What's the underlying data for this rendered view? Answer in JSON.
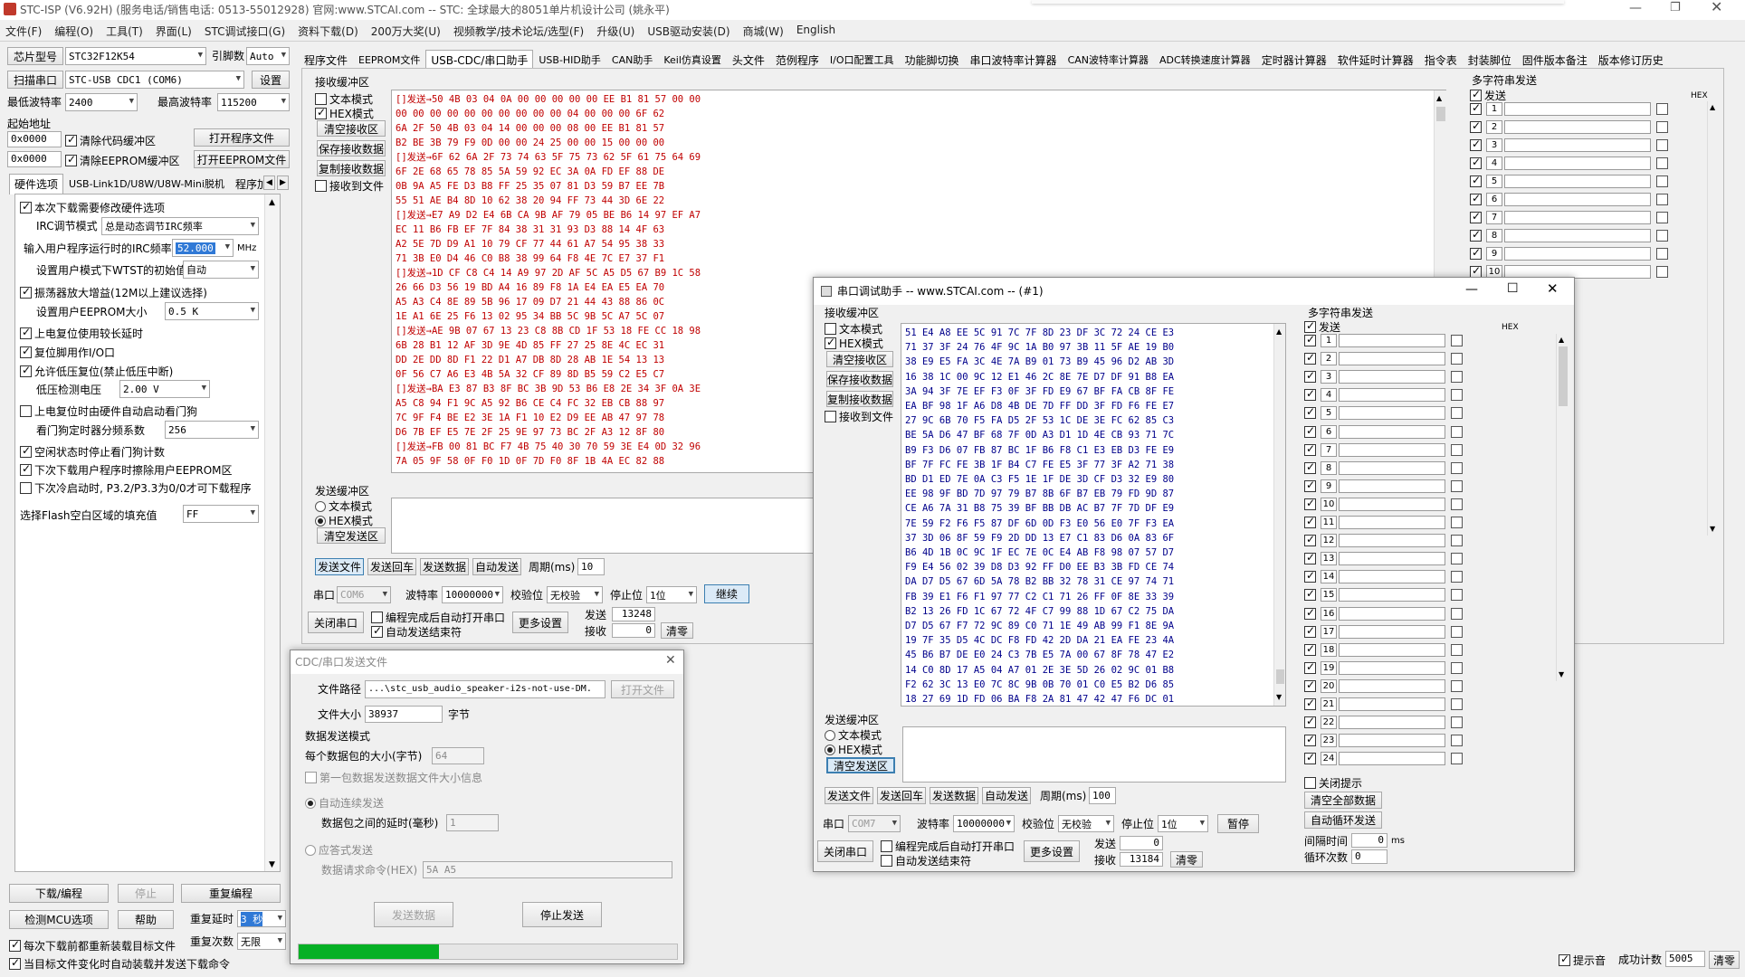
{
  "window": {
    "title": "STC-ISP (V6.92H) (服务电话/销售电话: 0513-55012928) 官网:www.STCAI.com  -- STC: 全球最大的8051单片机设计公司 (姚永平)"
  },
  "menu": [
    "文件(F)",
    "编程(O)",
    "工具(T)",
    "界面(L)",
    "STC调试接口(G)",
    "资料下载(D)",
    "200万大奖(U)",
    "视频教学/技术论坛/选型(F)",
    "升级(U)",
    "USB驱动安装(D)",
    "商城(W)",
    "English"
  ],
  "left": {
    "chip_label": "芯片型号",
    "chip_value": "STC32F12K54",
    "pin_label": "引脚数",
    "pin_value": "Auto",
    "scan_btn": "扫描串口",
    "port_value": "STC-USB CDC1 (COM6)",
    "settings_btn": "设置",
    "min_baud_label": "最低波特率",
    "min_baud": "2400",
    "max_baud_label": "最高波特率",
    "max_baud": "115200",
    "start_addr_label": "起始地址",
    "addr1": "0x0000",
    "clear_code": "清除代码缓冲区",
    "open_prog": "打开程序文件",
    "addr2": "0x0000",
    "clear_eeprom": "清除EEPROM缓冲区",
    "open_eeprom": "打开EEPROM文件",
    "tabs": [
      "硬件选项",
      "USB-Link1D/U8W/U8W-Mini脱机",
      "程序加"
    ],
    "opts": {
      "o1": "本次下载需要修改硬件选项",
      "irc_mode_label": "IRC调节模式",
      "irc_mode": "总是动态调节IRC频率",
      "irc_freq_label": "输入用户程序运行时的IRC频率",
      "irc_freq": "52.000",
      "mhz": "MHz",
      "wtst_label": "设置用户模式下WTST的初始值",
      "wtst": "自动",
      "o2": "振荡器放大增益(12M以上建议选择)",
      "eeprom_label": "设置用户EEPROM大小",
      "eeprom": "0.5 K",
      "o3": "上电复位使用较长延时",
      "o4": "复位脚用作I/O口",
      "o5": "允许低压复位(禁止低压中断)",
      "lv_label": "低压检测电压",
      "lv": "2.00 V",
      "o6": "上电复位时由硬件自动启动看门狗",
      "wdt_label": "看门狗定时器分频系数",
      "wdt": "256",
      "o7": "空闲状态时停止看门狗计数",
      "o8": "下次下载用户程序时擦除用户EEPROM区",
      "o9": "下次冷启动时, P3.2/P3.3为0/0才可下载程序",
      "fill_label": "选择Flash空白区域的填充值",
      "fill": "FF"
    },
    "dl_btn": "下载/编程",
    "stop_btn": "停止",
    "redl_btn": "重复编程",
    "check_btn": "检测MCU选项",
    "help_btn": "帮助",
    "delay_label": "重复延时",
    "delay_val": "3 秒",
    "reload_cb": "每次下载前都重新装载目标文件",
    "count_label": "重复次数",
    "count_val": "无限",
    "auto_cb": "当目标文件变化时自动装载并发送下载命令"
  },
  "top_tabs": [
    "程序文件",
    "EEPROM文件",
    "USB-CDC/串口助手",
    "USB-HID助手",
    "CAN助手",
    "Keil仿真设置",
    "头文件",
    "范例程序",
    "I/O口配置工具",
    "功能脚切换",
    "串口波特率计算器",
    "CAN波特率计算器",
    "ADC转换速度计算器",
    "定时器计算器",
    "软件延时计算器",
    "指令表",
    "封装脚位",
    "固件版本备注",
    "版本修订历史"
  ],
  "main": {
    "recv_title": "接收缓冲区",
    "text_mode": "文本模式",
    "hex_mode": "HEX模式",
    "clear_recv": "清空接收区",
    "save_recv": "保存接收数据",
    "copy_recv": "复制接收数据",
    "recv_file": "接收到文件",
    "hex_lines": [
      {
        "s": "[]发送→50 4B 03 04 0A 00 00 00 00 00 EE B1 81 57 00 00",
        "r": true
      },
      {
        "s": "00 00 00 00 00 00 00 00 00 00 04 00 00 00 6F 62",
        "r": true
      },
      {
        "s": "6A 2F 50 4B 03 04 14 00 00 00 08 00 EE B1 81 57",
        "r": true
      },
      {
        "s": "B2 BE 3B 79 F9 0D 00 00 24 25 00 00 15 00 00 00",
        "r": true
      },
      {
        "s": "[]发送→6F 62 6A 2F 73 74 63 5F 75 73 62 5F 61 75 64 69",
        "r": true
      },
      {
        "s": "6F 2E 68 65 78 85 5A 59 92 EC 3A 0A FD EF 88 DE",
        "r": true
      },
      {
        "s": "0B 9A A5 FE D3 B8 FF 25 35 07 81 D3 59 B7 EE 7B",
        "r": true
      },
      {
        "s": "55 51 AE B4 8D 10 62 38 20 94 FF 73 44 3D 6E 22",
        "r": true
      },
      {
        "s": "[]发送→E7 A9 D2 E4 6B CA 9B AF 79 05 BE B6 14 97 EF A7",
        "r": true
      },
      {
        "s": "EC 11 B6 FB EF 7F 84 38 31 31 93 D3 88 14 4F 63",
        "r": true
      },
      {
        "s": "A2 5E 7D D9 A1 10 79 CF 77 44 61 A7 54 95 38 33",
        "r": true
      },
      {
        "s": "71 3B E0 D4 46 C0 B8 38 99 64 F8 4E 7C E7 37 F1",
        "r": true
      },
      {
        "s": "[]发送→1D CF C8 C4 14 A9 97 2D AF 5C A5 D5 67 B9 1C 58",
        "r": true
      },
      {
        "s": "26 66 D3 56 19 BD A4 16 89 F8 1A E4 EA E5 EA 70",
        "r": true
      },
      {
        "s": "A5 A3 C4 8E 89 5B 96 17 09 D7 21 44 43 88 86 0C",
        "r": true
      },
      {
        "s": "1E A1 6E 25 F6 13 02 95 34 BB 5C 9B 5C A7 5C 07",
        "r": true
      },
      {
        "s": "[]发送→AE 9B 07 67 13 23 C8 8B CD 1F 53 18 FE CC 18 98",
        "r": true
      },
      {
        "s": "6B 28 B1 12 AF 3D 9E 4D 85 FF 27 25 8E 4C EC 31",
        "r": true
      },
      {
        "s": "DD 2E DD 8D F1 22 D1 A7 DB 8D 28 AB 1E 54 13 13",
        "r": true
      },
      {
        "s": "0F 56 C7 A6 E3 4B 5A 32 CF 89 8D B5 59 C2 E5 C7",
        "r": true
      },
      {
        "s": "[]发送→BA E3 87 B3 8F BC 3B 9D 53 B6 E8 2E 34 3F 0A 3E",
        "r": true
      },
      {
        "s": "A5 C8 94 F1 9C A5 92 B6 CE C4 FC 32 EB CB 88 97",
        "r": true
      },
      {
        "s": "7C 9F F4 BE E2 3E 1A F1 10 E2 D9 EE AB 47 97 78",
        "r": true
      },
      {
        "s": "D6 7B EF E5 7E 2F 25 9E 97 73 BC 2F A3 12 8F 80",
        "r": true
      },
      {
        "s": "[]发送→FB 00 81 BC F7 4B 75 40 30 70 59 3E E4 0D 32 96",
        "r": true
      },
      {
        "s": "7A 05 9F 58 0F F0 1D 0F 7D F0 8F 1B 4A EC 82 88",
        "r": true
      }
    ],
    "send_title": "发送缓冲区",
    "clear_send": "清空发送区",
    "send_file": "发送文件",
    "send_back": "发送回车",
    "send_data": "发送数据",
    "auto_send": "自动发送",
    "period_label": "周期(ms)",
    "period": "10",
    "port_label": "串口",
    "port": "COM6",
    "baud_label": "波特率",
    "baud": "10000000",
    "parity_label": "校验位",
    "parity": "无校验",
    "stop_label": "停止位",
    "stopbit": "1位",
    "continue_btn": "继续",
    "close_port": "关闭串口",
    "cb_open": "编程完成后自动打开串口",
    "cb_end": "自动发送结束符",
    "more_settings": "更多设置",
    "sent_label": "发送",
    "sent": "13248",
    "recv_label": "接收",
    "recv": "0",
    "clear_btn": "清零"
  },
  "multi": {
    "title": "多字符串发送",
    "send_col": "发送",
    "hex_col": "HEX",
    "rows": [
      "1",
      "2",
      "3",
      "4",
      "5",
      "6",
      "7",
      "8",
      "9",
      "10"
    ]
  },
  "status": {
    "tip": "提示音",
    "success_label": "成功计数",
    "success": "5005",
    "clear": "清零"
  },
  "file_dialog": {
    "title": "CDC/串口发送文件",
    "path_label": "文件路径",
    "path": "...\\stc_usb_audio_speaker-i2s-not-use-DM.",
    "open_file": "打开文件",
    "size_label": "文件大小",
    "size": "38937",
    "size_unit": "字节",
    "mode_title": "数据发送模式",
    "pkt_label": "每个数据包的大小(字节)",
    "pkt": "64",
    "first_pkt": "第一包数据发送数据文件大小信息",
    "auto_mode": "自动连续发送",
    "delay_label": "数据包之间的延时(毫秒)",
    "delay": "1",
    "reply_mode": "应答式发送",
    "req_label": "数据请求命令(HEX)",
    "req": "5A A5",
    "send_btn": "发送数据",
    "stop_btn": "停止发送",
    "progress": 0.37
  },
  "assist": {
    "title": "串口调试助手 -- www.STCAI.com -- (#1)",
    "recv_title": "接收缓冲区",
    "text_mode": "文本模式",
    "hex_mode": "HEX模式",
    "clear_recv": "清空接收区",
    "save_recv": "保存接收数据",
    "copy_recv": "复制接收数据",
    "recv_file": "接收到文件",
    "hex_lines": [
      "51 E4 A8 EE 5C 91 7C 7F 8D 23 DF 3C 72 24 CE E3",
      "71 37 3F 24 76 4F 9C 1A B0 97 3B 11 5F AE 19 B0",
      "38 E9 E5 FA 3C 4E 7A B9 01 73 B9 45 96 D2 AB 3D",
      "16 38 1C 00 9C 12 E1 46 2C 8E 7E D7 DF 91 B8 EA",
      "3A 94 3F 7E EF F3 0F 3F FD E9 67 BF FA CB 8F FE",
      "EA BF 98 1F A6 D8 4B DE 7D FF DD 3F FD F6 FE E7",
      "27 9C 6B 70 F5 FA D5 2F 53 1C DE 3E FC 62 85 C3",
      "BE 5A D6 47 BF 68 7F 0D A3 D1 1D 4E CB 93 71 7C",
      "B9 F3 D6 07 FB 87 BC 1F B6 F8 C1 E3 EB D3 FE E9",
      "BF 7F FC FE 3B 1F B4 C7 FE E5 3F 77 3F A2 71 38",
      "BD D1 ED 7E 0A C3 F5 1E 1F DE 3D CF D3 32 E9 80",
      "EE 98 9F BD 7D 97 79 B7 8B 6F B7 EB 79 FD 9D 87",
      "CE A6 7A 31 B8 75 39 BF BB DB AC B7 7F 7D DF E9",
      "7E 59 F2 F6 F5 87 DF 6D 0D F3 E0 56 E0 7F F3 EA",
      "37 3D 06 8F 59 F9 2D DD 13 E7 C1 83 D6 0A 83 6F",
      "B6 4D 1B 0C 9C 1F EC 7E 0C E4 AB F8 98 07 57 D7",
      "F9 E4 56 02 39 D8 D3 92 FF D0 EE B3 3B FD CE 74",
      "DA D7 D5 67 6D 5A 78 B2 BB 32 78 31 CE 97 74 71",
      "FB 39 E1 F6 F1 97 77 C2 C1 71 26 FF 0F 8E 33 39",
      "B2 13 26 FD 1C 67 72 4F C7 99 88 1D 67 C2 75 DA",
      "D7 D5 67 F7 72 9C 89 C0 71 1E 49 AB 99 F1 8E 9A",
      "19 7F 35 D5 4C DC F8 FD 42 2D DA 21 EA FE 23 4A",
      "45 B6 B7 DE E0 24 C3 7B E5 7A 00 67 8F 78 47 E2",
      "14 C0 8D 17 A5 04 A7 01 2E 3E 5D 26 02 9C 01 B8",
      "F2 62 3C 13 E0 7C 8C 9B 0B 70 01 C0 E5 B2 D6 85",
      "18 27 69 1D FD 06 BA F8 2A 81 47 42 47 F6 DC 01"
    ],
    "send_title": "发送缓冲区",
    "clear_send": "清空发送区",
    "send_file": "发送文件",
    "send_back": "发送回车",
    "send_data": "发送数据",
    "auto_send": "自动发送",
    "period_label": "周期(ms)",
    "period": "100",
    "port_label": "串口",
    "port": "COM7",
    "baud_label": "波特率",
    "baud": "10000000",
    "parity_label": "校验位",
    "parity": "无校验",
    "stop_label": "停止位",
    "stopbit": "1位",
    "pause_btn": "暂停",
    "close_port": "关闭串口",
    "cb_open": "编程完成后自动打开串口",
    "cb_end": "自动发送结束符",
    "more_settings": "更多设置",
    "sent_label": "发送",
    "sent": "0",
    "recv_label": "接收",
    "recv": "13184",
    "clear_btn": "清零",
    "multi_title": "多字符串发送",
    "send_col": "发送",
    "hex_col": "HEX",
    "rows": [
      "1",
      "2",
      "3",
      "4",
      "5",
      "6",
      "7",
      "8",
      "9",
      "10",
      "11",
      "12",
      "13",
      "14",
      "15",
      "16",
      "17",
      "18",
      "19",
      "20",
      "21",
      "22",
      "23",
      "24"
    ],
    "close_tip": "关闭提示",
    "clear_all": "清空全部数据",
    "auto_loop": "自动循环发送",
    "interval_label": "间隔时间",
    "interval": "0",
    "interval_unit": "ms",
    "loop_label": "循环次数",
    "loop": "0"
  }
}
